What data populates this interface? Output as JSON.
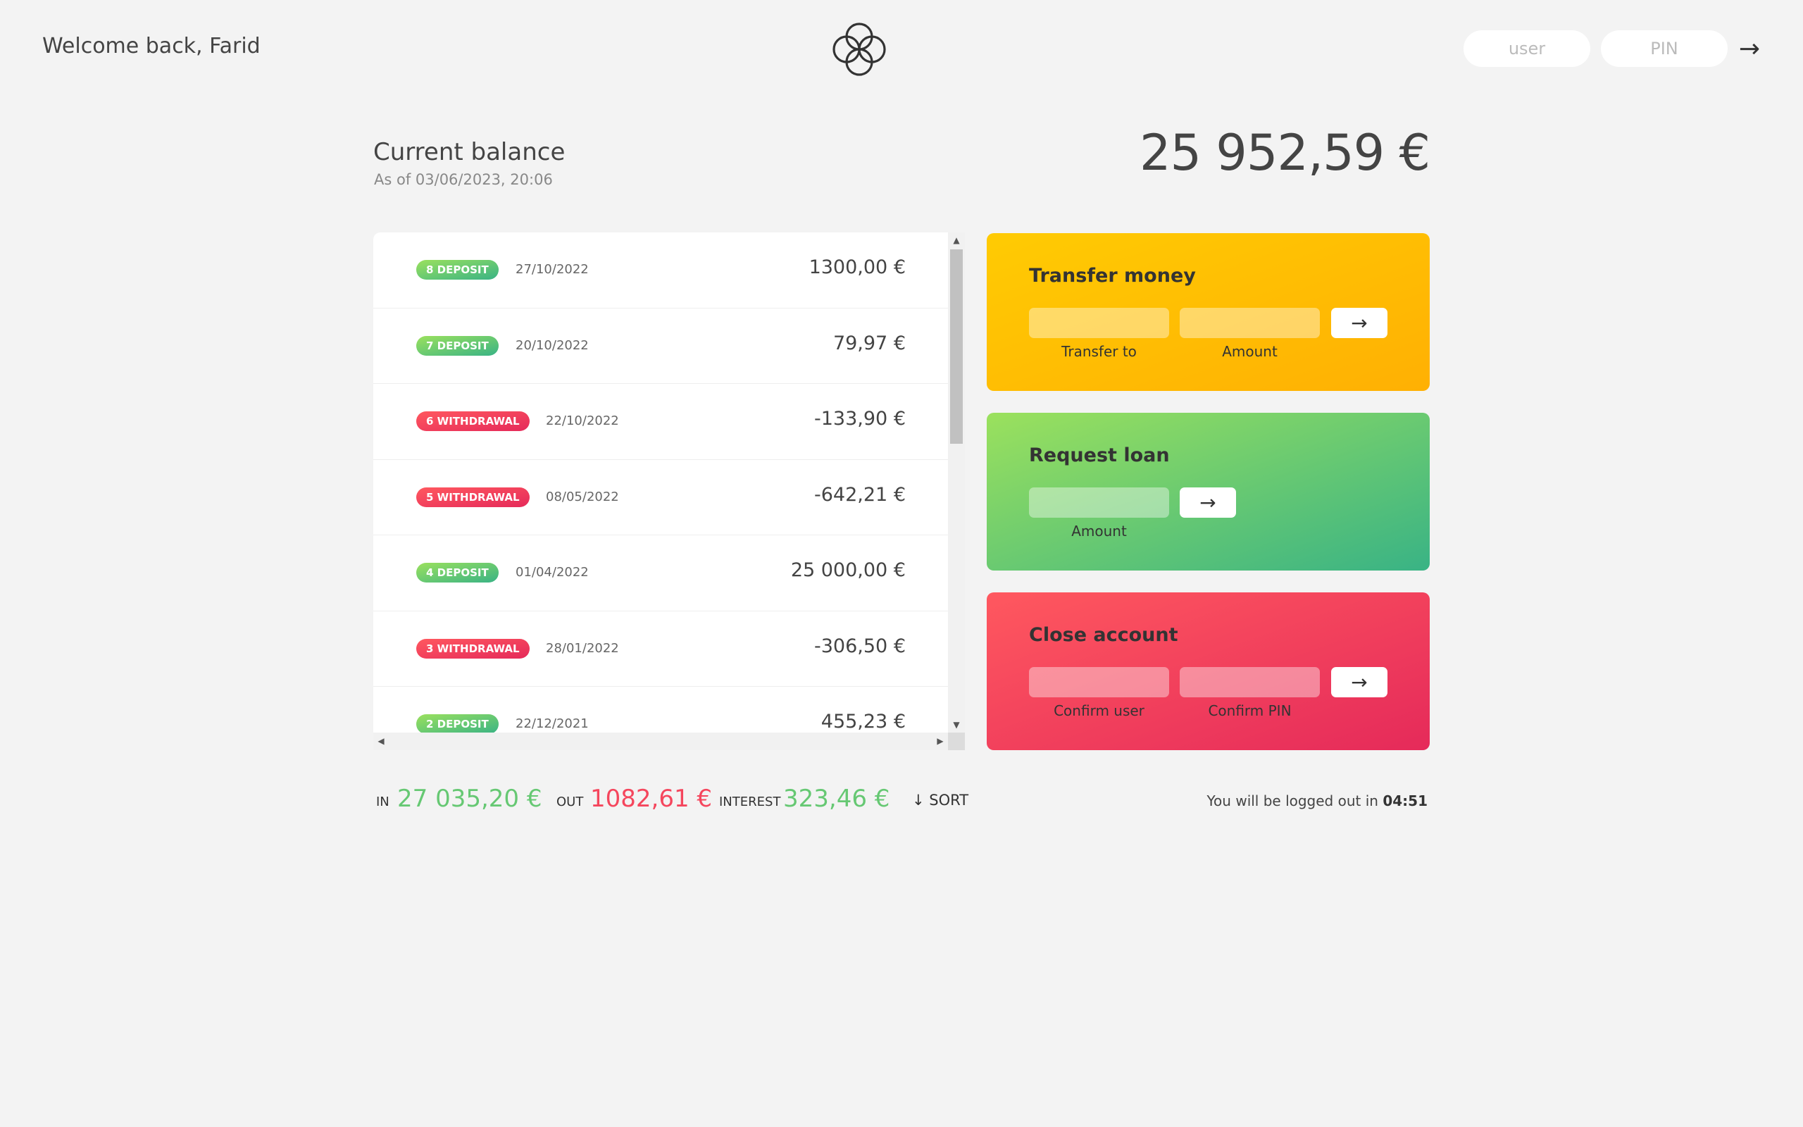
{
  "nav": {
    "welcome": "Welcome back, Farid",
    "login": {
      "user_placeholder": "user",
      "pin_placeholder": "PIN",
      "button": "→"
    }
  },
  "balance": {
    "label": "Current balance",
    "date": "As of 03/06/2023, 20:06",
    "value": "25 952,59 €"
  },
  "movements": [
    {
      "type_label": "8 DEPOSIT",
      "kind": "deposit",
      "date": "27/10/2022",
      "value": "1300,00 €"
    },
    {
      "type_label": "7 DEPOSIT",
      "kind": "deposit",
      "date": "20/10/2022",
      "value": "79,97 €"
    },
    {
      "type_label": "6 WITHDRAWAL",
      "kind": "withdrawal",
      "date": "22/10/2022",
      "value": "-133,90 €"
    },
    {
      "type_label": "5 WITHDRAWAL",
      "kind": "withdrawal",
      "date": "08/05/2022",
      "value": "-642,21 €"
    },
    {
      "type_label": "4 DEPOSIT",
      "kind": "deposit",
      "date": "01/04/2022",
      "value": "25 000,00 €"
    },
    {
      "type_label": "3 WITHDRAWAL",
      "kind": "withdrawal",
      "date": "28/01/2022",
      "value": "-306,50 €"
    },
    {
      "type_label": "2 DEPOSIT",
      "kind": "deposit",
      "date": "22/12/2021",
      "value": "455,23 €"
    }
  ],
  "operations": {
    "transfer": {
      "title": "Transfer money",
      "label1": "Transfer to",
      "label2": "Amount",
      "button": "→"
    },
    "loan": {
      "title": "Request loan",
      "label1": "Amount",
      "button": "→"
    },
    "close": {
      "title": "Close account",
      "label1": "Confirm user",
      "label2": "Confirm PIN",
      "button": "→"
    }
  },
  "summary": {
    "in_label": "In",
    "in_value": "27 035,20 €",
    "out_label": "Out",
    "out_value": "1082,61 €",
    "interest_label": "Interest",
    "interest_value": "323,46 €",
    "sort_label": "↓ SORT"
  },
  "logout": {
    "text": "You will be logged out in ",
    "timer": "04:51"
  },
  "colors": {
    "background": "#f3f3f3",
    "deposit": "#66c873",
    "withdrawal": "#f5465d",
    "transfer_card": "#ffb003",
    "loan_card": "#39b385",
    "close_card": "#e52a5a"
  }
}
